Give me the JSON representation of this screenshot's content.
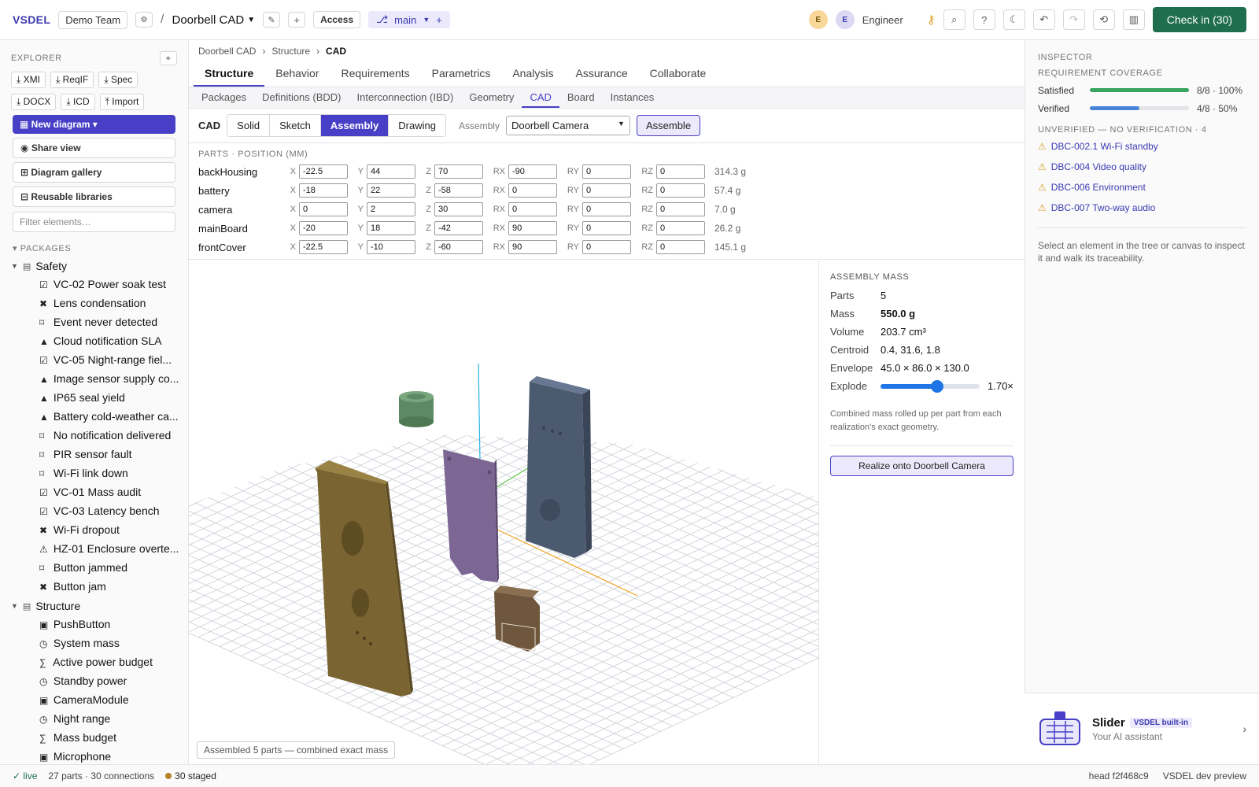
{
  "topbar": {
    "brand": "VSDEL",
    "team": "Demo Team",
    "project": "Doorbell CAD",
    "access": "Access",
    "branch": "main",
    "user_initial_1": "E",
    "user_initial_2": "E",
    "user_role": "Engineer",
    "checkin": "Check in (30)"
  },
  "sidebar": {
    "explorer_label": "EXPLORER",
    "exports": [
      "XMI",
      "ReqIF",
      "Spec",
      "DOCX",
      "ICD",
      "Import"
    ],
    "new_diagram": "New diagram",
    "share_view": "Share view",
    "gallery": "Diagram gallery",
    "libraries": "Reusable libraries",
    "filter_placeholder": "Filter elements…",
    "packages_label": "PACKAGES",
    "packages": [
      {
        "name": "Safety",
        "items": [
          {
            "icon": "☑",
            "label": "VC-02 Power soak test"
          },
          {
            "icon": "✖",
            "label": "Lens condensation"
          },
          {
            "icon": "⌑",
            "label": "Event never detected"
          },
          {
            "icon": "▲",
            "label": "Cloud notification SLA"
          },
          {
            "icon": "☑",
            "label": "VC-05 Night-range fiel..."
          },
          {
            "icon": "▲",
            "label": "Image sensor supply co..."
          },
          {
            "icon": "▲",
            "label": "IP65 seal yield"
          },
          {
            "icon": "▲",
            "label": "Battery cold-weather ca..."
          },
          {
            "icon": "⌑",
            "label": "No notification delivered"
          },
          {
            "icon": "⌑",
            "label": "PIR sensor fault"
          },
          {
            "icon": "⌑",
            "label": "Wi-Fi link down"
          },
          {
            "icon": "☑",
            "label": "VC-01 Mass audit"
          },
          {
            "icon": "☑",
            "label": "VC-03 Latency bench"
          },
          {
            "icon": "✖",
            "label": "Wi-Fi dropout"
          },
          {
            "icon": "⚠",
            "label": "HZ-01 Enclosure overte..."
          },
          {
            "icon": "⌑",
            "label": "Button jammed"
          },
          {
            "icon": "✖",
            "label": "Button jam"
          }
        ]
      },
      {
        "name": "Structure",
        "items": [
          {
            "icon": "▣",
            "label": "PushButton"
          },
          {
            "icon": "◷",
            "label": "System mass"
          },
          {
            "icon": "∑",
            "label": "Active power budget"
          },
          {
            "icon": "◷",
            "label": "Standby power"
          },
          {
            "icon": "▣",
            "label": "CameraModule"
          },
          {
            "icon": "◷",
            "label": "Night range"
          },
          {
            "icon": "∑",
            "label": "Mass budget"
          },
          {
            "icon": "▣",
            "label": "Microphone"
          }
        ]
      }
    ]
  },
  "breadcrumb": [
    "Doorbell CAD",
    "Structure",
    "CAD"
  ],
  "tabs": [
    "Structure",
    "Behavior",
    "Requirements",
    "Parametrics",
    "Analysis",
    "Assurance",
    "Collaborate"
  ],
  "subtabs": [
    "Packages",
    "Definitions (BDD)",
    "Interconnection (IBD)",
    "Geometry",
    "CAD",
    "Board",
    "Instances"
  ],
  "cad_toolbar": {
    "label": "CAD",
    "modes": [
      "Solid",
      "Sketch",
      "Assembly",
      "Drawing"
    ],
    "assembly_label": "Assembly",
    "assembly_value": "Doorbell Camera",
    "assemble": "Assemble"
  },
  "parts": {
    "heading": "PARTS · POSITION (MM)",
    "rows": [
      {
        "name": "backHousing",
        "x": "-22.5",
        "y": "44",
        "z": "70",
        "rx": "-90",
        "ry": "0",
        "rz": "0",
        "mass": "314.3 g"
      },
      {
        "name": "battery",
        "x": "-18",
        "y": "22",
        "z": "-58",
        "rx": "0",
        "ry": "0",
        "rz": "0",
        "mass": "57.4 g"
      },
      {
        "name": "camera",
        "x": "0",
        "y": "2",
        "z": "30",
        "rx": "0",
        "ry": "0",
        "rz": "0",
        "mass": "7.0 g"
      },
      {
        "name": "mainBoard",
        "x": "-20",
        "y": "18",
        "z": "-42",
        "rx": "90",
        "ry": "0",
        "rz": "0",
        "mass": "26.2 g"
      },
      {
        "name": "frontCover",
        "x": "-22.5",
        "y": "-10",
        "z": "-60",
        "rx": "90",
        "ry": "0",
        "rz": "0",
        "mass": "145.1 g"
      }
    ]
  },
  "viewport": {
    "status": "Assembled 5 parts — combined exact mass"
  },
  "assembly_mass": {
    "heading": "ASSEMBLY MASS",
    "rows": [
      {
        "k": "Parts",
        "v": "5"
      },
      {
        "k": "Mass",
        "v": "550.0 g"
      },
      {
        "k": "Volume",
        "v": "203.7 cm³"
      },
      {
        "k": "Centroid",
        "v": "0.4, 31.6, 1.8"
      },
      {
        "k": "Envelope",
        "v": "45.0 × 86.0 × 130.0"
      }
    ],
    "explode_label": "Explode",
    "explode_value": "1.70×",
    "explode_fraction": 0.57,
    "note": "Combined mass rolled up per part from each realization's exact geometry.",
    "realize": "Realize onto Doorbell Camera"
  },
  "inspector": {
    "heading": "INSPECTOR",
    "coverage_heading": "REQUIREMENT COVERAGE",
    "coverage": [
      {
        "k": "Satisfied",
        "fraction": 1.0,
        "pct": "8/8 · 100%",
        "color": "#3aa561"
      },
      {
        "k": "Verified",
        "fraction": 0.5,
        "pct": "4/8 · 50%",
        "color": "#4a84d8"
      }
    ],
    "unverified_heading": "UNVERIFIED — NO VERIFICATION · 4",
    "unverified": [
      "DBC-002.1 Wi-Fi standby",
      "DBC-004 Video quality",
      "DBC-006 Environment",
      "DBC-007 Two-way audio"
    ],
    "note": "Select an element in the tree or canvas to inspect it and walk its traceability."
  },
  "assistant": {
    "name": "Slider",
    "badge": "VSDEL built-in",
    "subtitle": "Your AI assistant"
  },
  "statusbar": {
    "live": "✓ live",
    "counts": "27 parts · 30 connections",
    "staged": "30 staged",
    "head": "head f2f468c9",
    "preview": "VSDEL dev preview"
  }
}
